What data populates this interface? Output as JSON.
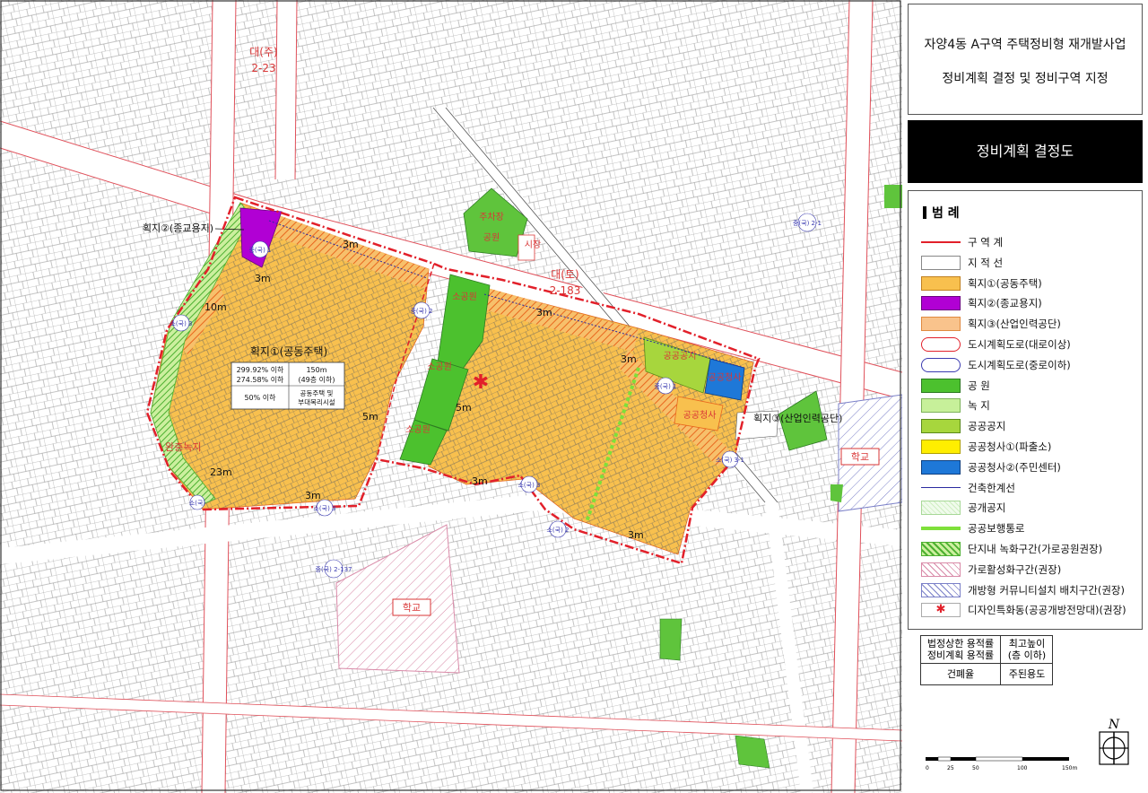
{
  "title": {
    "line1": "자양4동 A구역 주택정비형 재개발사업",
    "line2": "정비계획 결정 및 정비구역 지정"
  },
  "subtitle": "정비계획 결정도",
  "legend": {
    "heading": "범 례",
    "items": [
      {
        "label": "구 역 계"
      },
      {
        "label": "지 적 선"
      },
      {
        "label": "획지①(공동주택)"
      },
      {
        "label": "획지②(종교용지)"
      },
      {
        "label": "획지③(산업인력공단)"
      },
      {
        "label": "도시계획도로(대로이상)"
      },
      {
        "label": "도시계획도로(중로이하)"
      },
      {
        "label": "공 원"
      },
      {
        "label": "녹 지"
      },
      {
        "label": "공공공지"
      },
      {
        "label": "공공청사①(파출소)"
      },
      {
        "label": "공공청사②(주민센터)"
      },
      {
        "label": "건축한계선"
      },
      {
        "label": "공개공지"
      },
      {
        "label": "공공보행통로"
      },
      {
        "label": "단지내 녹화구간(가로공원권장)"
      },
      {
        "label": "가로활성화구간(권장)"
      },
      {
        "label": "개방형 커뮤니티설치 배치구간(권장)"
      },
      {
        "label": "디자인특화동(공공개방전망대)(권장)"
      }
    ]
  },
  "key_box": {
    "c11": "법정상한 용적률",
    "c12": "정비계획 용적률",
    "c2": "최고높이",
    "c3": "(층 이하)",
    "c4": "건폐율",
    "c5": "주된용도"
  },
  "scale": {
    "t0": "0",
    "t1": "25",
    "t2": "50",
    "t3": "100",
    "t4": "150m"
  },
  "north": "N",
  "map": {
    "lot1_title": "획지①(공동주택)",
    "lot1_far_legal": "299.92% 이하",
    "lot1_far_plan": "274.58% 이하",
    "lot1_height": "150m",
    "lot1_floors": "(49층 이하)",
    "lot1_bcr": "50% 이하",
    "lot1_use1": "공동주택 및",
    "lot1_use2": "부대복리시설",
    "lot2_label": "획지②(종교용지)",
    "lot3_label": "획지③(산업인력공단)",
    "park_small": "소공원",
    "park_neighbor": "어린이공원",
    "park_parking": "주차장",
    "park_parking2": "공원",
    "market": "시장",
    "school": "학교",
    "public_space": "공공공지",
    "office1": "공공청사",
    "office2": "공공청사",
    "green_link": "완충녹지",
    "road_big1_a": "대(주)",
    "road_big1_b": "2-23",
    "road_big2_a": "대(토)",
    "road_big2_b": "2-183",
    "w3m_1": "3m",
    "w3m_2": "3m",
    "w3m_3": "3m",
    "w3m_4": "3m",
    "w3m_5": "3m",
    "w3m_6": "3m",
    "w3m_7": "3m",
    "w5m_1": "5m",
    "w5m_2": "5m",
    "w10m": "10m",
    "w23m": "23m",
    "mid_road_1": "중(국) 2-1",
    "mid_road_2": "중(국) 2-137",
    "mid_road_3": "소(국) 3",
    "mid_road_4": "소(국) 3",
    "mid_road_5": "중(국) 2",
    "mid_road_6": "소(국) 3",
    "mid_road_7": "중(국) 1",
    "mid_road_8": "소(국) 2",
    "mid_road_9": "중(국) 1",
    "mid_road_10": "소(국) 3-1",
    "mid_road_11": "소(국)"
  }
}
